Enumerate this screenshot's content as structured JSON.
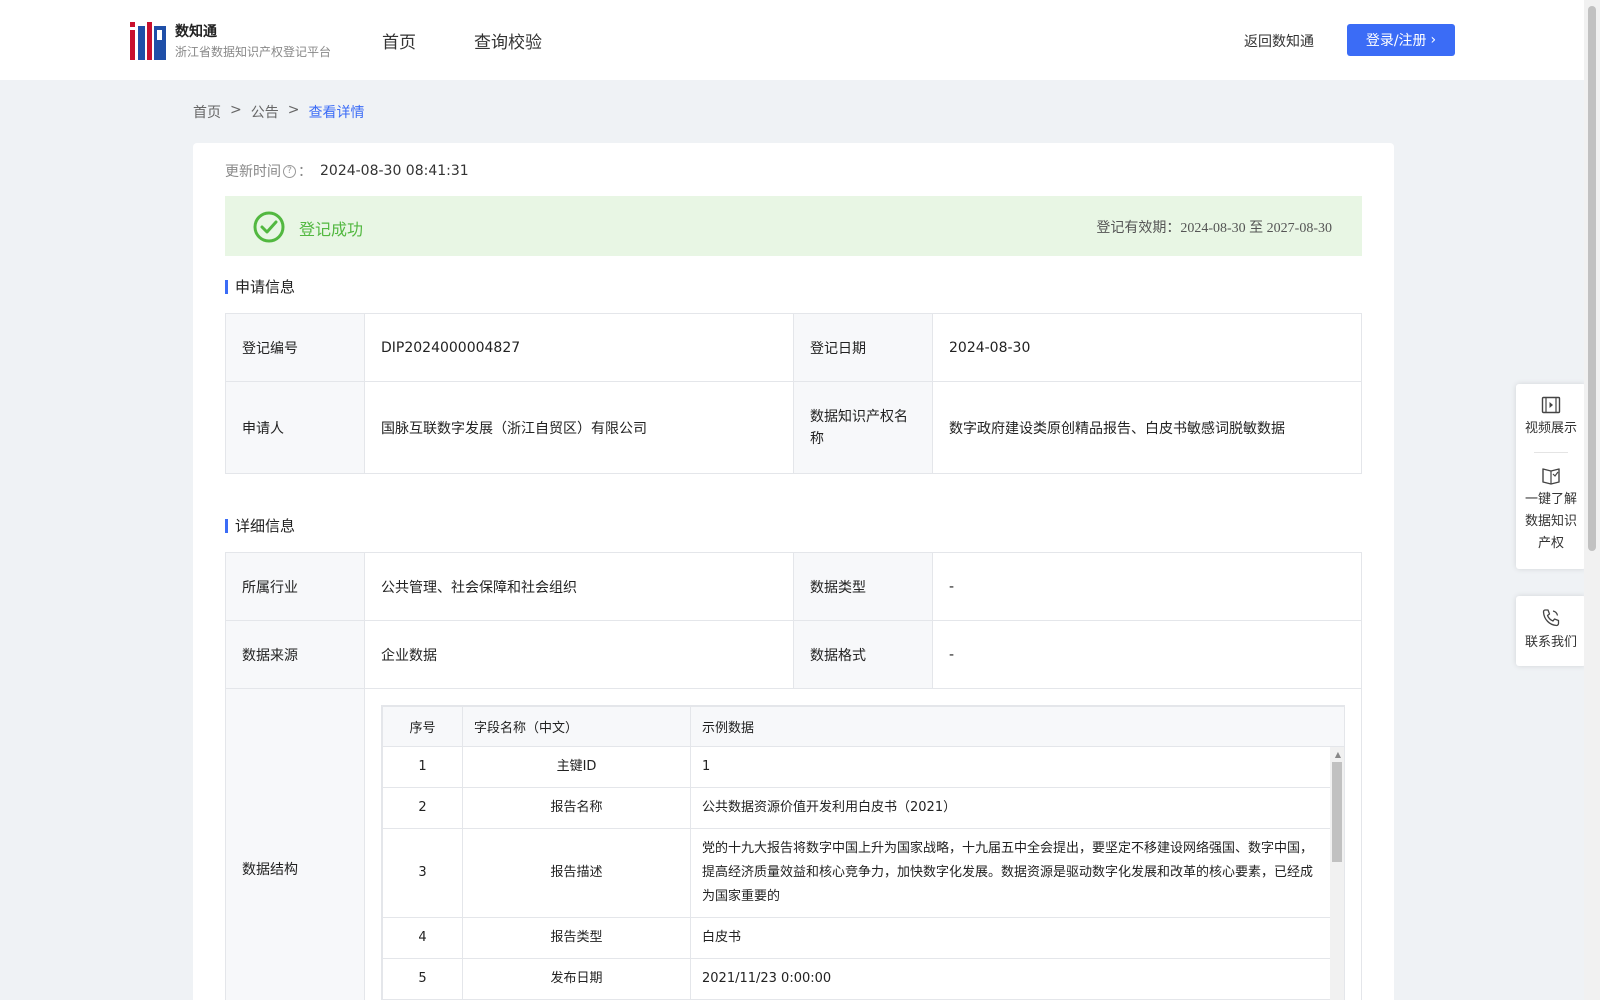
{
  "header": {
    "brand_title": "数知通",
    "brand_subtitle": "浙江省数据知识产权登记平台",
    "nav": [
      "首页",
      "查询校验"
    ],
    "back_link": "返回数知通",
    "login_label": "登录/注册"
  },
  "breadcrumb": [
    "首页",
    "公告",
    "查看详情"
  ],
  "update": {
    "label": "更新时间",
    "value": "2024-08-30 08:41:31"
  },
  "status": {
    "text": "登记成功",
    "validity_label": "登记有效期：",
    "validity_value": "2024-08-30 至 2027-08-30",
    "color": "#52b840"
  },
  "apply_section": {
    "title": "申请信息",
    "reg_no_label": "登记编号",
    "reg_no": "DIP2024000004827",
    "reg_date_label": "登记日期",
    "reg_date": "2024-08-30",
    "applicant_label": "申请人",
    "applicant": "国脉互联数字发展（浙江自贸区）有限公司",
    "ip_name_label": "数据知识产权名称",
    "ip_name": "数字政府建设类原创精品报告、白皮书敏感词脱敏数据"
  },
  "detail_section": {
    "title": "详细信息",
    "industry_label": "所属行业",
    "industry": "公共管理、社会保障和社会组织",
    "data_type_label": "数据类型",
    "data_type": "-",
    "source_label": "数据来源",
    "source": "企业数据",
    "format_label": "数据格式",
    "format": "-",
    "structure_label": "数据结构"
  },
  "structure_table": {
    "headers": [
      "序号",
      "字段名称（中文）",
      "示例数据"
    ],
    "rows": [
      [
        "1",
        "主键ID",
        "1"
      ],
      [
        "2",
        "报告名称",
        "公共数据资源价值开发利用白皮书（2021）"
      ],
      [
        "3",
        "报告描述",
        "党的十九大报告将数字中国上升为国家战略，十九届五中全会提出，要坚定不移建设网络强国、数字中国，提高经济质量效益和核心竞争力，加快数字化发展。数据资源是驱动数字化发展和改革的核心要素，已经成为国家重要的"
      ],
      [
        "4",
        "报告类型",
        "白皮书"
      ],
      [
        "5",
        "发布日期",
        "2021/11/23 0:00:00"
      ]
    ]
  },
  "float_panel": {
    "video": "视频展示",
    "learn": "一键了解数据知识产权",
    "contact": "联系我们"
  },
  "colors": {
    "accent": "#3b6cf6",
    "success": "#52b840",
    "success_bg": "#e8f6e4"
  }
}
